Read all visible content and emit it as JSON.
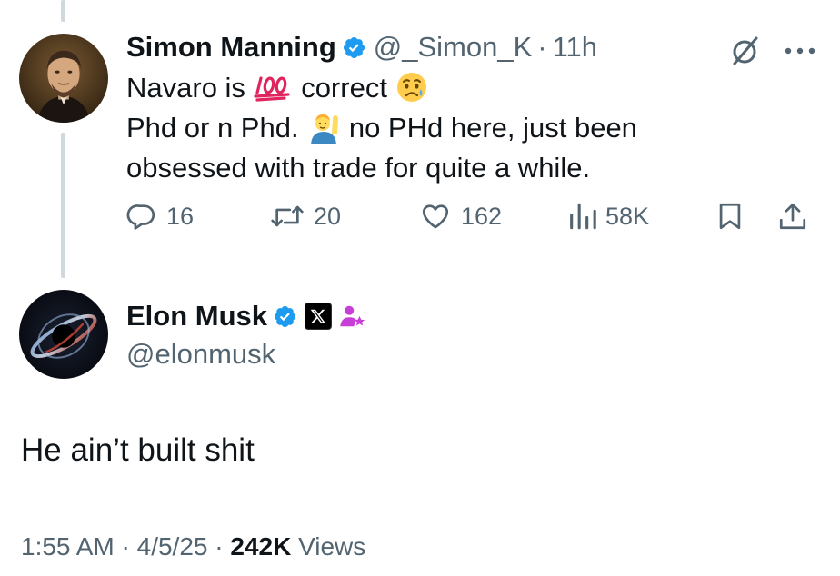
{
  "parent_tweet": {
    "author_name": "Simon Manning",
    "handle": "@_Simon_K",
    "separator": "·",
    "time_ago": "11h",
    "text_line1_a": "Navaro is",
    "text_line1_b": "correct",
    "text_line2_a": "Phd or n Phd.",
    "text_line2_b": "no PHd here, just been",
    "text_line3": "obsessed with trade for quite a while.",
    "emojis": [
      "hundred-points-emoji",
      "sad-relieved-face-emoji",
      "person-raising-hand-emoji"
    ],
    "actions": {
      "replies": "16",
      "retweets": "20",
      "likes": "162",
      "views": "58K"
    }
  },
  "reply_tweet": {
    "author_name": "Elon Musk",
    "handle": "@elonmusk",
    "text": "He ain’t built shit",
    "time": "1:55 AM",
    "date": "4/5/25",
    "separator": "·",
    "views_count": "242K",
    "views_label": "Views"
  },
  "colors": {
    "verified_blue": "#1d9bf0",
    "secondary_text": "#536471",
    "primary_text": "#0f1419",
    "thread_line": "#cfd9de",
    "affiliate_badge": "#c73fd6"
  }
}
